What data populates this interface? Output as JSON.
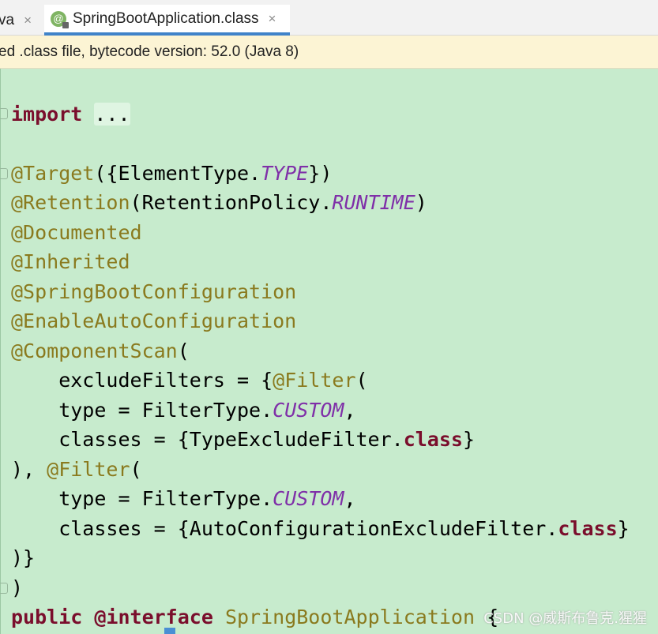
{
  "tabs": [
    {
      "label": "va",
      "close": "×"
    },
    {
      "label": "SpringBootApplication.class",
      "close": "×",
      "icon": "@",
      "active": true
    }
  ],
  "infobar": {
    "text": "ed .class file, bytecode version: 52.0 (Java 8)"
  },
  "code": {
    "import_kw": "import",
    "import_folded": "...",
    "l1_ann": "@Target",
    "l1_a": "({ElementType.",
    "l1_const": "TYPE",
    "l1_b": "})",
    "l2_ann": "@Retention",
    "l2_a": "(RetentionPolicy.",
    "l2_const": "RUNTIME",
    "l2_b": ")",
    "l3_ann": "@Documented",
    "l4_ann": "@Inherited",
    "l5_ann": "@SpringBootConfiguration",
    "l6_ann": "@EnableAutoConfiguration",
    "l7_ann": "@ComponentScan",
    "l7_b": "(",
    "l8_a": "    excludeFilters = {",
    "l8_ann": "@Filter",
    "l8_b": "(",
    "l9_a": "    type = FilterType.",
    "l9_const": "CUSTOM",
    "l9_b": ",",
    "l10_a": "    classes = {TypeExcludeFilter.",
    "l10_kw": "class",
    "l10_b": "}",
    "l11_a": "), ",
    "l11_ann": "@Filter",
    "l11_b": "(",
    "l12_a": "    type = FilterType.",
    "l12_const": "CUSTOM",
    "l12_b": ",",
    "l13_a": "    classes = {AutoConfigurationExcludeFilter.",
    "l13_kw": "class",
    "l13_b": "}",
    "l14": ")}",
    "l15": ")",
    "l16_kw1": "public",
    "l16_kw2": "@interface",
    "l16_name": "SpringBootApplication",
    "l16_b": " {"
  },
  "watermark": "CSDN @威斯布鲁克.猩猩"
}
